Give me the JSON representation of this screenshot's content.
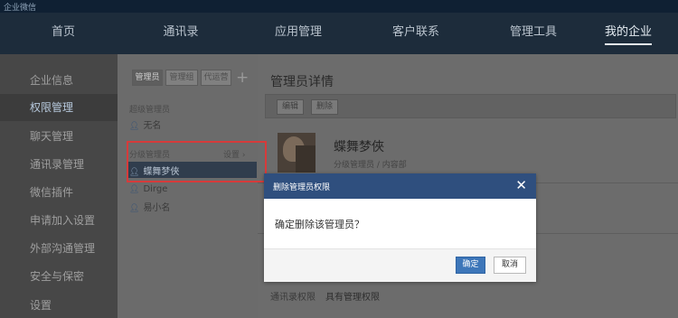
{
  "topbar": {
    "logo": "企业微信",
    "right": ""
  },
  "nav": [
    {
      "label": "首页"
    },
    {
      "label": "通讯录"
    },
    {
      "label": "应用管理"
    },
    {
      "label": "客户联系"
    },
    {
      "label": "管理工具"
    },
    {
      "label": "我的企业"
    }
  ],
  "sidebar": [
    {
      "label": "企业信息"
    },
    {
      "label": "权限管理"
    },
    {
      "label": "聊天管理"
    },
    {
      "label": "通讯录管理"
    },
    {
      "label": "微信插件"
    },
    {
      "label": "申请加入设置"
    },
    {
      "label": "外部沟通管理"
    },
    {
      "label": "安全与保密"
    },
    {
      "label": "设置"
    }
  ],
  "admin_tabs": [
    {
      "label": "管理员"
    },
    {
      "label": "管理组"
    },
    {
      "label": "代运营"
    }
  ],
  "add_symbol": "+",
  "super_admin": {
    "group_label": "超级管理员",
    "name": "无名"
  },
  "sub_admin": {
    "group_label": "分级管理员",
    "settings_label": "设置 ›",
    "members": [
      {
        "name": "蝶舞梦俠"
      },
      {
        "name": "Dirge"
      },
      {
        "name": "易小名"
      }
    ]
  },
  "detail": {
    "title": "管理员详情",
    "edit_label": "编辑",
    "delete_label": "删除",
    "user_name": "蝶舞梦俠",
    "user_role": "分级管理员 / 内容部",
    "perm_label": "通讯录权限",
    "perm_value": "具有管理权限"
  },
  "modal": {
    "title": "删除管理员权限",
    "close": "✕",
    "message": "确定删除该管理员？",
    "confirm": "确定",
    "cancel": "取消"
  },
  "colors": {
    "highlight_border": "#d63b3b",
    "modal_header": "#2f4f7e",
    "primary_button": "#3d76b9"
  }
}
